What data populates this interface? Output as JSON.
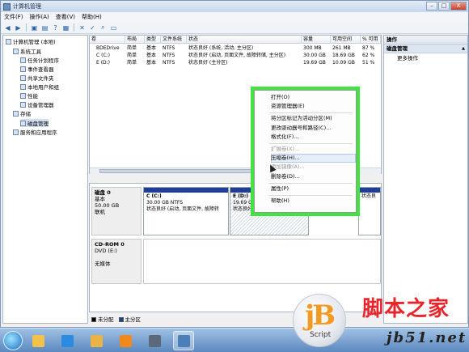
{
  "window": {
    "title": "计算机管理",
    "buttons": [
      "–",
      "□",
      "X"
    ]
  },
  "menu": [
    "文件(F)",
    "操作(A)",
    "查看(V)",
    "帮助(H)"
  ],
  "toolbar_icons": [
    "back-arrow-icon",
    "forward-arrow-icon",
    "folder-up-icon",
    "properties-icon",
    "help-icon",
    "refresh-icon",
    "delete-icon",
    "check-icon",
    "search-icon",
    "disk-icon"
  ],
  "tree": [
    {
      "label": "计算机管理 (本地)",
      "indent": 0
    },
    {
      "label": "系统工具",
      "indent": 1
    },
    {
      "label": "任务计划程序",
      "indent": 2
    },
    {
      "label": "事件查看器",
      "indent": 2
    },
    {
      "label": "共享文件夹",
      "indent": 2
    },
    {
      "label": "本地用户和组",
      "indent": 2
    },
    {
      "label": "性能",
      "indent": 2
    },
    {
      "label": "设备管理器",
      "indent": 2
    },
    {
      "label": "存储",
      "indent": 1
    },
    {
      "label": "磁盘管理",
      "indent": 2,
      "selected": true
    },
    {
      "label": "服务和应用程序",
      "indent": 1
    }
  ],
  "volume_table": {
    "columns": [
      "卷",
      "布局",
      "类型",
      "文件系统",
      "状态",
      "容量",
      "可用空间",
      "% 可用"
    ],
    "rows": [
      [
        "BDEDrive",
        "简单",
        "基本",
        "NTFS",
        "状态良好 (系统, 活动, 主分区)",
        "300 MB",
        "261 MB",
        "87 %"
      ],
      [
        "C (C:)",
        "简单",
        "基本",
        "NTFS",
        "状态良好 (启动, 页面文件, 故障转储, 主分区)",
        "30.00 GB",
        "18.69 GB",
        "62 %"
      ],
      [
        "E (D:)",
        "简单",
        "基本",
        "NTFS",
        "状态良好 (主分区)",
        "19.69 GB",
        "10.09 GB",
        "51 %"
      ]
    ]
  },
  "disks": [
    {
      "name": "磁盘 0",
      "lines": [
        "基本",
        "50.00 GB",
        "联机"
      ],
      "partitions": [
        {
          "title": "C (C:)",
          "lines": [
            "30.00 GB NTFS",
            "状态良好 (启动, 页面文件, 故障转"
          ]
        },
        {
          "title": "E (D:)",
          "lines": [
            "19.69 GB",
            "状态良好"
          ]
        },
        {
          "title": "",
          "lines": [
            "状态良"
          ]
        }
      ]
    },
    {
      "name": "CD-ROM 0",
      "lines": [
        "DVD (E:)",
        "",
        "无媒体"
      ]
    }
  ],
  "legend": [
    {
      "label": "未分配",
      "color": "#000000"
    },
    {
      "label": "主分区",
      "color": "#1f3f96"
    }
  ],
  "actions": {
    "header": "操作",
    "section": "磁盘管理",
    "items": [
      "更多操作"
    ]
  },
  "context_menu": {
    "items": [
      {
        "label": "打开(O)",
        "enabled": true
      },
      {
        "label": "资源管理器(E)",
        "enabled": true
      },
      {
        "sep": true
      },
      {
        "label": "将分区标记为活动分区(M)",
        "enabled": true
      },
      {
        "label": "更改驱动器号和路径(C)...",
        "enabled": true
      },
      {
        "label": "格式化(F)...",
        "enabled": true
      },
      {
        "sep": true
      },
      {
        "label": "扩展卷(X)...",
        "enabled": false
      },
      {
        "label": "压缩卷(H)...",
        "enabled": true,
        "highlighted": true
      },
      {
        "label": "添加镜像(A)...",
        "enabled": false
      },
      {
        "label": "删除卷(D)...",
        "enabled": true
      },
      {
        "sep": true
      },
      {
        "label": "属性(P)",
        "enabled": true
      },
      {
        "sep": true
      },
      {
        "label": "帮助(H)",
        "enabled": true
      }
    ]
  },
  "taskbar": {
    "apps": [
      {
        "name": "explorer-icon",
        "color": "#f2c24a"
      },
      {
        "name": "ie-icon",
        "color": "#2b8be0"
      },
      {
        "name": "folder-icon",
        "color": "#e9b445"
      },
      {
        "name": "media-player-icon",
        "color": "#f08a1d"
      },
      {
        "name": "terminal-icon",
        "color": "#5a6a7a"
      },
      {
        "name": "computer-management-icon",
        "color": "#4c7fb8"
      }
    ]
  },
  "watermark": {
    "logo_big": "jB",
    "logo_small": "Script",
    "site_name": "脚本之家",
    "url": "jb51.net"
  }
}
